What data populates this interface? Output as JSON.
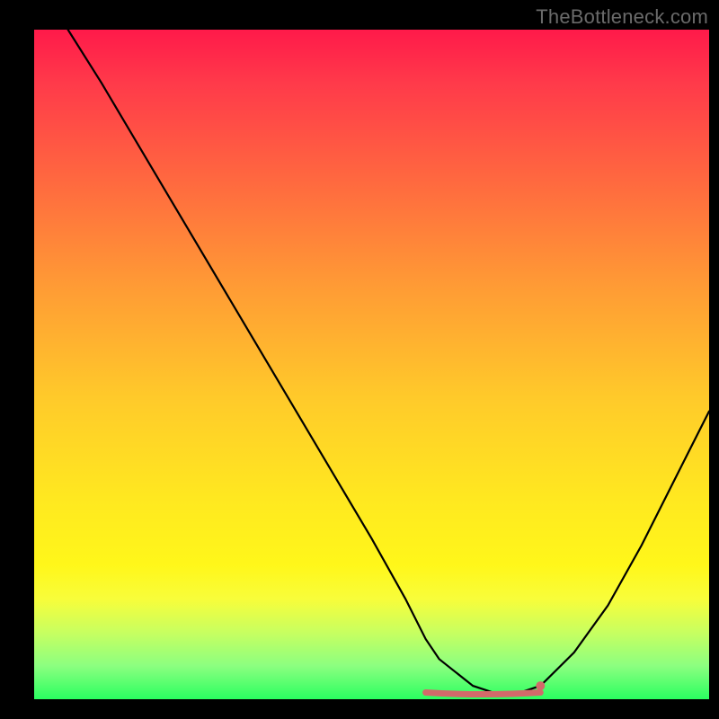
{
  "watermark": "TheBottleneck.com",
  "chart_data": {
    "type": "line",
    "title": "",
    "xlabel": "",
    "ylabel": "",
    "xlim": [
      0,
      100
    ],
    "ylim": [
      0,
      100
    ],
    "grid": false,
    "series": [
      {
        "name": "bottleneck-curve",
        "x": [
          5,
          10,
          20,
          30,
          40,
          50,
          55,
          58,
          60,
          65,
          68,
          70,
          72,
          75,
          80,
          85,
          90,
          95,
          100
        ],
        "y": [
          100,
          92,
          75,
          58,
          41,
          24,
          15,
          9,
          6,
          2,
          1,
          1,
          1,
          2,
          7,
          14,
          23,
          33,
          43
        ]
      }
    ],
    "highlight": {
      "name": "optimal-flat-zone",
      "x_start": 58,
      "x_end": 75,
      "y": 1,
      "marker_x": 75,
      "marker_y": 2,
      "color": "#d26a6a"
    },
    "background_gradient": {
      "top": "#ff1a4a",
      "mid": "#ffe820",
      "bottom": "#2aff60"
    }
  }
}
